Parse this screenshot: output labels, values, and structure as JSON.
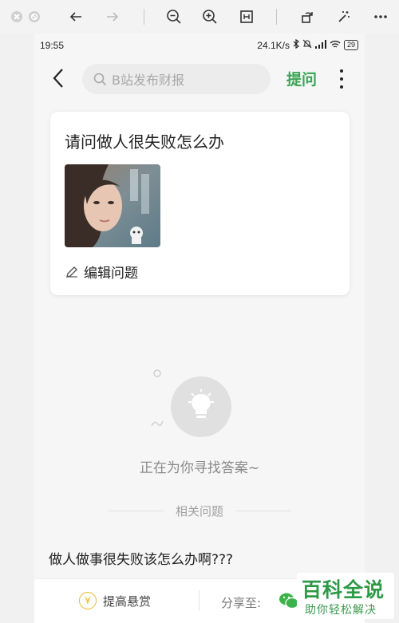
{
  "viewer_toolbar": {
    "icons": [
      "close-icon",
      "disabled-circle-icon",
      "arrow-left-icon",
      "arrow-right-icon",
      "zoom-out-icon",
      "zoom-in-icon",
      "fit-icon",
      "rotate-icon",
      "magic-wand-icon",
      "more-icon"
    ]
  },
  "status_bar": {
    "time": "19:55",
    "speed": "24.1K/s",
    "battery": "29"
  },
  "nav": {
    "search_placeholder": "B站发布财报",
    "ask_label": "提问"
  },
  "question": {
    "title": "请问做人很失败怎么办",
    "edit_label": "编辑问题"
  },
  "empty_state": {
    "text": "正在为你寻找答案~"
  },
  "related": {
    "heading": "相关问题",
    "items": [
      "做人做事很失败该怎么办啊???"
    ]
  },
  "bottom_bar": {
    "reward_icon": "¥",
    "reward_label": "提高悬赏",
    "share_label": "分享至:"
  },
  "watermark": {
    "title": "百科全说",
    "subtitle": "助你轻松解决"
  },
  "colors": {
    "accent": "#3aa554",
    "reward": "#e6b92a"
  }
}
